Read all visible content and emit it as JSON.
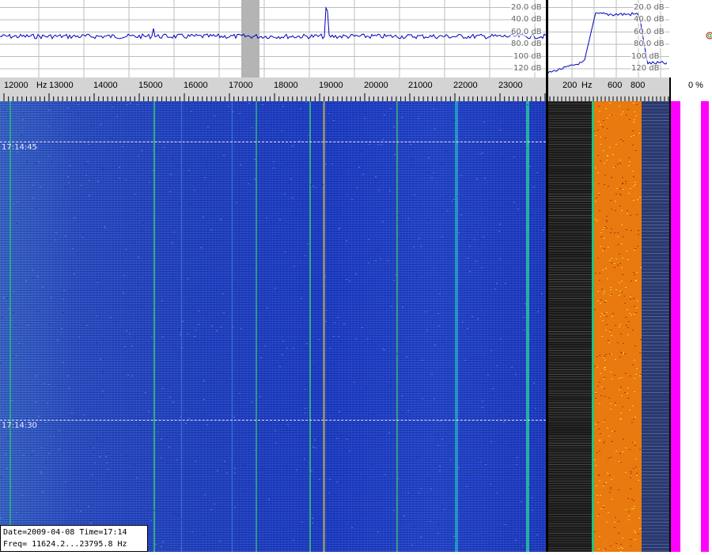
{
  "spectrum_main": {
    "db_labels": [
      "20.0 dB",
      "40.0 dB",
      "60.0 dB",
      "80.0 dB",
      "100 dB",
      "120 dB"
    ]
  },
  "spectrum_zoom": {
    "db_labels": [
      "20.0 dB",
      "40.0 dB",
      "60.0 dB",
      "80.0 dB",
      "100 dB",
      "120 dB"
    ]
  },
  "frequency_scale": {
    "unit_label": "Hz",
    "labels": [
      "12000",
      "13000",
      "14000",
      "15000",
      "16000",
      "17000",
      "18000",
      "19000",
      "20000",
      "21000",
      "22000",
      "23000"
    ]
  },
  "zoom_scale": {
    "unit_label": "Hz",
    "labels": [
      "200",
      "600",
      "800"
    ]
  },
  "meter_scale": {
    "label": "0 %"
  },
  "waterfall": {
    "time_marks": [
      "17:14:45",
      "17:14:30"
    ]
  },
  "info": {
    "date_time": "Date=2009-04-08 Time=17:14",
    "freq_range": "Freq= 11624.2...23795.8 Hz"
  },
  "colors": {
    "waterfall_blue": "#2346c4",
    "trace_blue": "#0000c0",
    "highlight_gray": "#b4b4b4",
    "meter_magenta": "#ff00ff",
    "zoom_orange": "#e87a10"
  }
}
